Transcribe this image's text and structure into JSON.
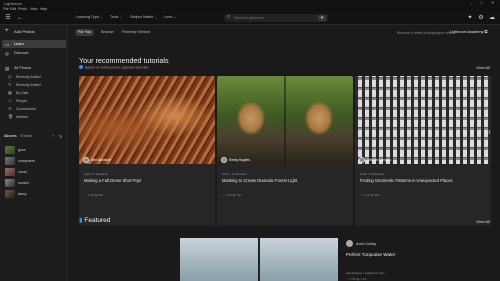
{
  "window": {
    "title": "Lightroom",
    "min": "–",
    "max": "□",
    "close": "✕"
  },
  "menu": [
    "File",
    "Edit",
    "Photo",
    "View",
    "Help"
  ],
  "toolbar": {
    "filters": [
      {
        "label": "Learning Type",
        "chev": "⌄"
      },
      {
        "label": "Tools",
        "chev": "⌄"
      },
      {
        "label": "Subject Matter",
        "chev": "⌄"
      },
      {
        "label": "Level",
        "chev": "⌄"
      }
    ],
    "search_placeholder": "Search Lightroom",
    "search_icon": "⌕",
    "filter_icon": "▼",
    "menu_icon": "☰",
    "back_icon": "←",
    "help_icon": "✦",
    "settings_icon": "⚙",
    "profile_icon": "☁"
  },
  "sidebar": {
    "add_photos": "Add Photos",
    "learn": "Learn",
    "discover": "Discover",
    "all_photos": "All Photos",
    "sub_items": [
      {
        "label": "Recently Added",
        "count": ""
      },
      {
        "label": "Recently Edited",
        "count": ""
      },
      {
        "label": "By Date",
        "count": ""
      },
      {
        "label": "People",
        "count": ""
      },
      {
        "label": "Connections",
        "count": ""
      },
      {
        "label": "Deleted",
        "count": ""
      }
    ],
    "tabs": [
      "Albums",
      "Shared"
    ],
    "albums": [
      {
        "label": "gcse",
        "count": ""
      },
      {
        "label": "computers",
        "count": ""
      },
      {
        "label": "cloud",
        "count": ""
      },
      {
        "label": "sunset",
        "count": ""
      },
      {
        "label": "fancy",
        "count": ""
      }
    ]
  },
  "subnav": {
    "tabs": [
      "For You",
      "Browse",
      "Recently Viewed"
    ],
    "teacher_text": "Become a better photographer with",
    "academy_link": "Lightroom Academy ⧉"
  },
  "recommended": {
    "title": "Your recommended tutorials",
    "subtitle": "Based on what you've captured and like",
    "view_all": "View All"
  },
  "cards": [
    {
      "author": "Alex Bandurin",
      "meta": "Light • 5 Sessions",
      "title": "Making a Fall Drone Shot Pop!",
      "stats": "♡ 1.2K  ▤ 890"
    },
    {
      "author": "Emmy Hughes",
      "meta": "Color • 4 Sessions",
      "title": "Masking to Create Dramatic Forest Light",
      "stats": "♡ 1.8K  ▤ 780"
    },
    {
      "author": "Victoria Sampaio",
      "meta": "Color • 3 Sessions",
      "title": "Finding Geometric Patterns in Unexpected Places",
      "stats": "♡ 2.1K  ▤ 920"
    }
  ],
  "next_arrow": "›",
  "featured": {
    "title": "Featured",
    "view_all": "View All",
    "author": "Anish Gahlay",
    "item_title": "Perfect Turquoise Water",
    "meta": "Landscapes • Lightroom Tips",
    "stats": "♡ 3.5K  ▤ 1.1K"
  }
}
